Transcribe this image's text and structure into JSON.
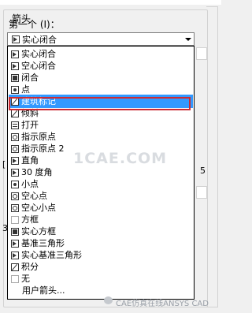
{
  "group": {
    "title": "箭头"
  },
  "first": {
    "label": "第一个 (I)："
  },
  "combo": {
    "value": "实心闭合"
  },
  "dropdown": {
    "items": [
      {
        "label": "实心闭合",
        "icon": "solid-closed-arrow-icon"
      },
      {
        "label": "空心闭合",
        "icon": "hollow-closed-arrow-icon"
      },
      {
        "label": "闭合",
        "icon": "closed-arrow-icon"
      },
      {
        "label": "点",
        "icon": "dot-icon"
      },
      {
        "label": "建筑标记",
        "icon": "architectural-tick-icon",
        "selected": true
      },
      {
        "label": "倾斜",
        "icon": "oblique-icon"
      },
      {
        "label": "打开",
        "icon": "open-arrow-icon"
      },
      {
        "label": "指示原点",
        "icon": "origin-indicator-icon"
      },
      {
        "label": "指示原点 2",
        "icon": "origin-indicator-2-icon"
      },
      {
        "label": "直角",
        "icon": "right-angle-icon"
      },
      {
        "label": "30 度角",
        "icon": "open-30-icon"
      },
      {
        "label": "小点",
        "icon": "dot-small-icon"
      },
      {
        "label": "空心点",
        "icon": "dot-blank-icon"
      },
      {
        "label": "空心小点",
        "icon": "dot-small-blank-icon"
      },
      {
        "label": "方框",
        "icon": "box-blank-icon"
      },
      {
        "label": "实心方框",
        "icon": "box-filled-icon"
      },
      {
        "label": "基准三角形",
        "icon": "datum-triangle-icon"
      },
      {
        "label": "实心基准三角形",
        "icon": "datum-triangle-filled-icon"
      },
      {
        "label": "积分",
        "icon": "integral-icon"
      },
      {
        "label": "无",
        "icon": "none-icon"
      },
      {
        "label": "用户箭头...",
        "icon": ""
      }
    ]
  },
  "watermarks": {
    "center": "1CAE.COM",
    "bottom": "CAE仿真在线ANSYS CAD"
  },
  "side_fragments": [
    "[",
    "5",
    "3"
  ],
  "colors": {
    "selection": "#3399ff",
    "highlight_box": "#cc2b33"
  }
}
